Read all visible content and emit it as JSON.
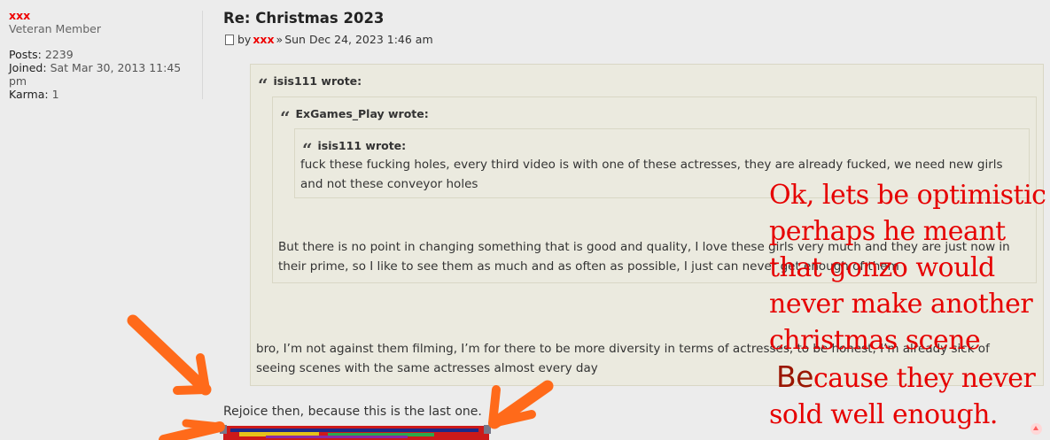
{
  "profile": {
    "username": "xxx",
    "rank": "Veteran Member",
    "posts_label": "Posts:",
    "posts_value": "2239",
    "joined_label": "Joined:",
    "joined_value": "Sat Mar 30, 2013 11:45",
    "joined_value_cont": "pm",
    "karma_label": "Karma:",
    "karma_value": "1"
  },
  "post": {
    "title": "Re: Christmas 2023",
    "by": "by",
    "author": "xxx",
    "sep": "»",
    "date": "Sun Dec 24, 2023 1:46 am"
  },
  "quotes": {
    "outer": {
      "header": "isis111 wrote:",
      "text": "bro, I’m not against them filming, I’m for there to be more diversity in terms of actresses, to be honest, I’m already sick of seeing scenes with the same actresses almost every day"
    },
    "middle": {
      "header": "ExGames_Play wrote:",
      "text": "But there is no point in changing something that is good and quality, I love these girls very much and they are just now in their prime, so I like to see them as much and as often as possible, I just can never get enough of them"
    },
    "inner": {
      "header": "isis111 wrote:",
      "text": "fuck these fucking holes, every third video is with one of these actresses, they are already fucked, we need new girls and not these conveyor holes"
    }
  },
  "reply_text": "Rejoice then, because this is the last one.",
  "annotation": {
    "lines": [
      "Ok, lets be optimistic",
      "perhaps he meant",
      "that gonzo would",
      "never make another",
      "christmas scene"
    ],
    "be": "Be",
    "be_rest": "cause they never",
    "last": "sold well enough."
  },
  "colors": {
    "author": "#e00000",
    "annotation": "#e60000",
    "arrow": "#ff6a1a",
    "quote_bg": "#ebeadf"
  },
  "icons": {
    "post": "document-icon",
    "quote": "quote-icon",
    "top": "scroll-up-icon"
  }
}
